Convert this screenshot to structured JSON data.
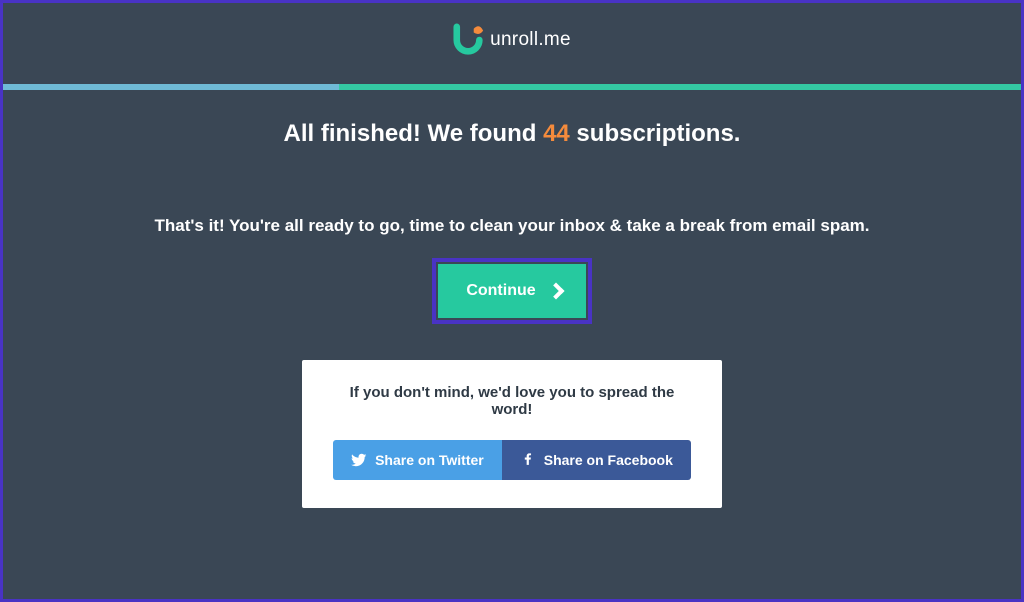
{
  "brand": {
    "name": "unroll.me"
  },
  "headline": {
    "prefix": "All finished! We found ",
    "count": "44",
    "suffix": " subscriptions."
  },
  "subhead": "That's it! You're all ready to go, time to clean your inbox & take a break from email spam.",
  "continue": {
    "label": "Continue"
  },
  "share": {
    "title": "If you don't mind, we'd love you to spread the word!",
    "twitter_label": "Share on Twitter",
    "facebook_label": "Share on Facebook"
  },
  "colors": {
    "accent_teal": "#26c99f",
    "accent_orange": "#f58b3c",
    "twitter": "#4aa0e6",
    "facebook": "#3b5998"
  }
}
